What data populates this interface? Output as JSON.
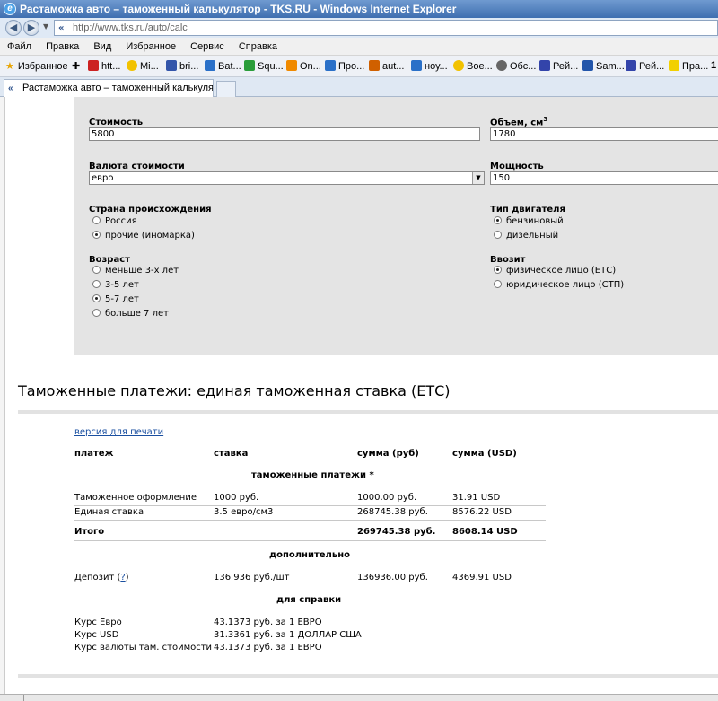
{
  "window": {
    "title": "Растаможка авто – таможенный калькулятор - TKS.RU - Windows Internet Explorer"
  },
  "address": {
    "url": "http://www.tks.ru/auto/calc"
  },
  "menu": [
    "Файл",
    "Правка",
    "Вид",
    "Избранное",
    "Сервис",
    "Справка"
  ],
  "favorites": {
    "label": "Избранное",
    "items": [
      {
        "label": "htt...",
        "icon": "page-icon",
        "color": "#cc2222"
      },
      {
        "label": "Mi...",
        "icon": "smile-icon",
        "color": "#f2c200"
      },
      {
        "label": "bri...",
        "icon": "page-icon",
        "color": "#3355aa"
      },
      {
        "label": "Bat...",
        "icon": "ie-page-icon",
        "color": "#2a70c8"
      },
      {
        "label": "Squ...",
        "icon": "drive-icon",
        "color": "#2a9d3a"
      },
      {
        "label": "On...",
        "icon": "page-icon",
        "color": "#f08a00"
      },
      {
        "label": "Про...",
        "icon": "ie-page-icon",
        "color": "#2a70c8"
      },
      {
        "label": "aut...",
        "icon": "car-icon",
        "color": "#d06000"
      },
      {
        "label": "ноу...",
        "icon": "ie-page-icon",
        "color": "#2a70c8"
      },
      {
        "label": "Вое...",
        "icon": "smile-icon",
        "color": "#f2c200"
      },
      {
        "label": "Обс...",
        "icon": "gear-icon",
        "color": "#666666"
      },
      {
        "label": "Рей...",
        "icon": "nix-icon",
        "color": "#3344aa"
      },
      {
        "label": "Sam...",
        "icon": "page-icon",
        "color": "#2255aa"
      },
      {
        "label": "Рей...",
        "icon": "nix-icon",
        "color": "#3344aa"
      },
      {
        "label": "Пра...",
        "icon": "yellow-icon",
        "color": "#f2d000"
      }
    ],
    "overflow": "1"
  },
  "tab": {
    "label": "Растаможка авто – таможенный калькулятор - TK..."
  },
  "form": {
    "cost": {
      "label": "Стоимость",
      "value": "5800"
    },
    "volume": {
      "label": "Объем, см",
      "sup": "3",
      "value": "1780"
    },
    "currency": {
      "label": "Валюта стоимости",
      "value": "евро"
    },
    "power": {
      "label": "Мощность",
      "value": "150"
    },
    "origin": {
      "label": "Страна происхождения",
      "options": [
        {
          "label": "Россия",
          "checked": false
        },
        {
          "label": "прочие (иномарка)",
          "checked": true
        }
      ]
    },
    "engine": {
      "label": "Тип двигателя",
      "options": [
        {
          "label": "бензиновый",
          "checked": true
        },
        {
          "label": "дизельный",
          "checked": false
        }
      ]
    },
    "age": {
      "label": "Возраст",
      "options": [
        {
          "label": "меньше 3-х лет",
          "checked": false
        },
        {
          "label": "3-5 лет",
          "checked": false
        },
        {
          "label": "5-7 лет",
          "checked": true
        },
        {
          "label": "больше 7 лет",
          "checked": false
        }
      ]
    },
    "importer": {
      "label": "Ввозит",
      "options": [
        {
          "label": "физическое лицо (ЕТС)",
          "checked": true
        },
        {
          "label": "юридическое лицо (СТП)",
          "checked": false
        }
      ]
    }
  },
  "results": {
    "title": "Таможенные платежи: единая таможенная ставка (ЕТС)",
    "print_link": "версия для печати",
    "headers": [
      "платеж",
      "ставка",
      "сумма (руб)",
      "сумма (USD)"
    ],
    "section_customs": "таможенные платежи *",
    "rows": [
      [
        "Таможенное оформление",
        "1000 руб.",
        "1000.00 руб.",
        "31.91 USD"
      ],
      [
        "Единая ставка",
        "3.5 евро/см3",
        "268745.38 руб.",
        "8576.22 USD"
      ]
    ],
    "total": [
      "Итого",
      "269745.38 руб.",
      "8608.14 USD"
    ],
    "section_extra": "дополнительно",
    "deposit": {
      "label": "Депозит (",
      "help": "?",
      "close": ")",
      "rate": "136 936 руб./шт",
      "rub": "136936.00 руб.",
      "usd": "4369.91 USD"
    },
    "section_ref": "для справки",
    "refs": [
      [
        "Курс Евро",
        "43.1373 руб. за 1 ЕВРО"
      ],
      [
        "Курс USD",
        "31.3361 руб. за 1 ДОЛЛАР США"
      ],
      [
        "Курс валюты там. стоимости",
        "43.1373 руб. за 1 ЕВРО"
      ]
    ]
  }
}
